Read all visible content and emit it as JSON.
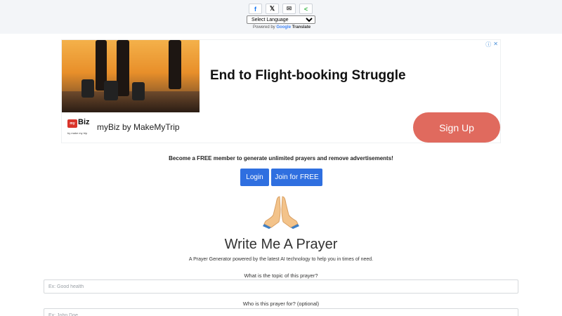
{
  "share": {
    "facebook_glyph": "f",
    "x_glyph": "𝕏",
    "email_glyph": "✉",
    "share_glyph": "<"
  },
  "translate": {
    "select_value": "Select Language",
    "powered_by": "Powered by",
    "google": "Google",
    "translate": "Translate"
  },
  "ad": {
    "headline": "End to Flight-booking Struggle",
    "brand": "myBiz by MakeMyTrip",
    "logo_tag": "my",
    "logo_word": "Biz",
    "logo_by": "by make my trip",
    "cta": "Sign Up",
    "cta_color": "#e06a5e"
  },
  "membership": {
    "message": "Become a FREE member to generate unlimited prayers and remove advertisements!",
    "login_label": "Login",
    "join_label": "Join for FREE",
    "button_color": "#2f6fe0"
  },
  "main": {
    "icon": "praying-hands-icon",
    "title": "Write Me A Prayer",
    "subtitle": "A Prayer Generator powered by the latest AI technology to help you in times of need.",
    "topic_question": "What is the topic of this prayer?",
    "topic_placeholder": "Ex: Good health",
    "for_question": "Who is this prayer for? (optional)",
    "for_placeholder": "Ex: John Doe"
  }
}
